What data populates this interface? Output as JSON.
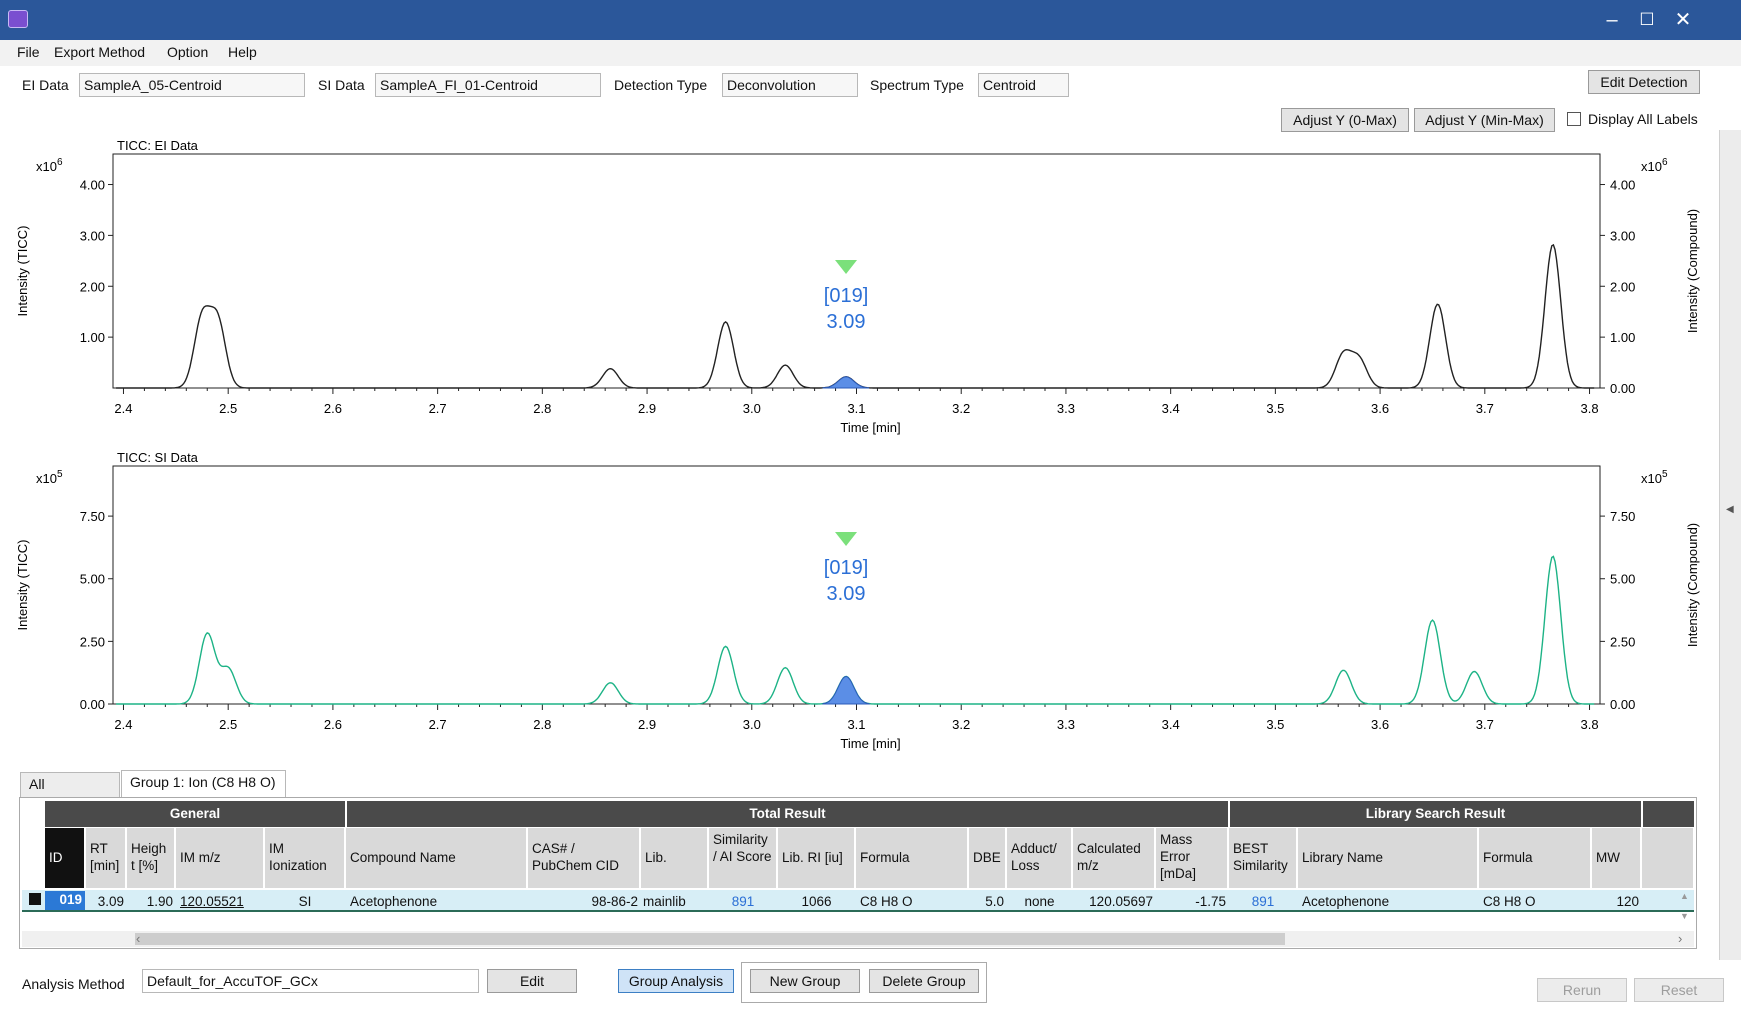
{
  "menu": [
    "File",
    "Export Method",
    "Option",
    "Help"
  ],
  "top": {
    "ei_label": "EI Data",
    "ei_value": "SampleA_05-Centroid",
    "si_label": "SI Data",
    "si_value": "SampleA_FI_01-Centroid",
    "det_label": "Detection Type",
    "det_value": "Deconvolution",
    "spec_label": "Spectrum Type",
    "spec_value": "Centroid",
    "edit_detection": "Edit Detection",
    "adjust_0max": "Adjust Y (0-Max)",
    "adjust_minmax": "Adjust Y (Min-Max)",
    "display_all_labels": "Display All Labels"
  },
  "charts": [
    {
      "title": "TICC: EI Data",
      "y_left_label": "Intensity (TICC)",
      "y_right_label": "Intensity (Compound)",
      "scale": "x10^6",
      "y_ticks": [
        "4.00",
        "3.00",
        "2.00",
        "1.00"
      ],
      "y_right_ticks": [
        "4.00",
        "3.00",
        "2.00",
        "1.00",
        "0.00"
      ],
      "x_label": "Time [min]",
      "marker_id": "[019]",
      "marker_rt": "3.09",
      "line_color": "#222222"
    },
    {
      "title": "TICC: SI Data",
      "y_left_label": "Intensity (TICC)",
      "y_right_label": "Intensity (Compound)",
      "scale": "x10^5",
      "y_ticks": [
        "7.50",
        "5.00",
        "2.50",
        "0.00"
      ],
      "y_right_ticks": [
        "7.50",
        "5.00",
        "2.50",
        "0.00"
      ],
      "x_label": "Time [min]",
      "marker_id": "[019]",
      "marker_rt": "3.09",
      "line_color": "#1db386"
    }
  ],
  "chart_data": [
    {
      "type": "line",
      "title": "TICC: EI Data",
      "xlabel": "Time [min]",
      "ylabel": "Intensity (TICC)",
      "xlim": [
        2.39,
        3.81
      ],
      "ylim": [
        0,
        4.6
      ],
      "y_scale_label": "x10^6",
      "x_ticks": [
        2.4,
        2.5,
        2.6,
        2.7,
        2.8,
        2.9,
        3.0,
        3.1,
        3.2,
        3.3,
        3.4,
        3.5,
        3.6,
        3.7,
        3.8
      ],
      "peaks": [
        {
          "x": 2.475,
          "y": 1.35
        },
        {
          "x": 2.49,
          "y": 1.3
        },
        {
          "x": 2.865,
          "y": 0.38
        },
        {
          "x": 2.975,
          "y": 1.3
        },
        {
          "x": 3.032,
          "y": 0.45
        },
        {
          "x": 3.09,
          "y": 0.22
        },
        {
          "x": 3.565,
          "y": 0.65
        },
        {
          "x": 3.58,
          "y": 0.55
        },
        {
          "x": 3.655,
          "y": 1.65
        },
        {
          "x": 3.765,
          "y": 2.82
        }
      ],
      "highlight": {
        "x": 3.09,
        "label": "[019]"
      }
    },
    {
      "type": "line",
      "title": "TICC: SI Data",
      "xlabel": "Time [min]",
      "ylabel": "Intensity (TICC)",
      "xlim": [
        2.39,
        3.81
      ],
      "ylim": [
        0,
        9.5
      ],
      "y_scale_label": "x10^5",
      "x_ticks": [
        2.4,
        2.5,
        2.6,
        2.7,
        2.8,
        2.9,
        3.0,
        3.1,
        3.2,
        3.3,
        3.4,
        3.5,
        3.6,
        3.7,
        3.8
      ],
      "peaks": [
        {
          "x": 2.48,
          "y": 2.8
        },
        {
          "x": 2.5,
          "y": 1.4
        },
        {
          "x": 2.865,
          "y": 0.85
        },
        {
          "x": 2.975,
          "y": 2.3
        },
        {
          "x": 3.032,
          "y": 1.45
        },
        {
          "x": 3.09,
          "y": 1.1
        },
        {
          "x": 3.565,
          "y": 1.35
        },
        {
          "x": 3.65,
          "y": 3.35
        },
        {
          "x": 3.69,
          "y": 1.3
        },
        {
          "x": 3.765,
          "y": 5.9
        }
      ],
      "highlight": {
        "x": 3.09,
        "label": "[019]"
      }
    }
  ],
  "tabs": [
    "All",
    "Group 1: Ion (C8 H8 O)"
  ],
  "table": {
    "groups": [
      "General",
      "Total Result",
      "Library Search Result"
    ],
    "headers": [
      "ID",
      "RT [min]",
      "Heigh t [%]",
      "IM m/z",
      "IM Ionization",
      "Compound Name",
      "CAS# / PubChem CID",
      "Lib.",
      "Similarity / AI Score",
      "Lib. RI [iu]",
      "Formula",
      "DBE",
      "Adduct/ Loss",
      "Calculated m/z",
      "Mass Error [mDa]",
      "BEST Similarity",
      "Library Name",
      "Formula",
      "MW"
    ],
    "row": [
      "019",
      "3.09",
      "1.90",
      "120.05521",
      "SI",
      "Acetophenone",
      "98-86-2",
      "mainlib",
      "891",
      "1066",
      "C8 H8 O",
      "5.0",
      "none",
      "120.05697",
      "-1.75",
      "891",
      "Acetophenone",
      "C8 H8 O",
      "120"
    ]
  },
  "bottom": {
    "analysis_label": "Analysis Method",
    "analysis_value": "Default_for_AccuTOF_GCx",
    "edit": "Edit",
    "group_analysis": "Group Analysis",
    "new_group": "New Group",
    "delete_group": "Delete Group",
    "rerun": "Rerun",
    "reset": "Reset"
  }
}
